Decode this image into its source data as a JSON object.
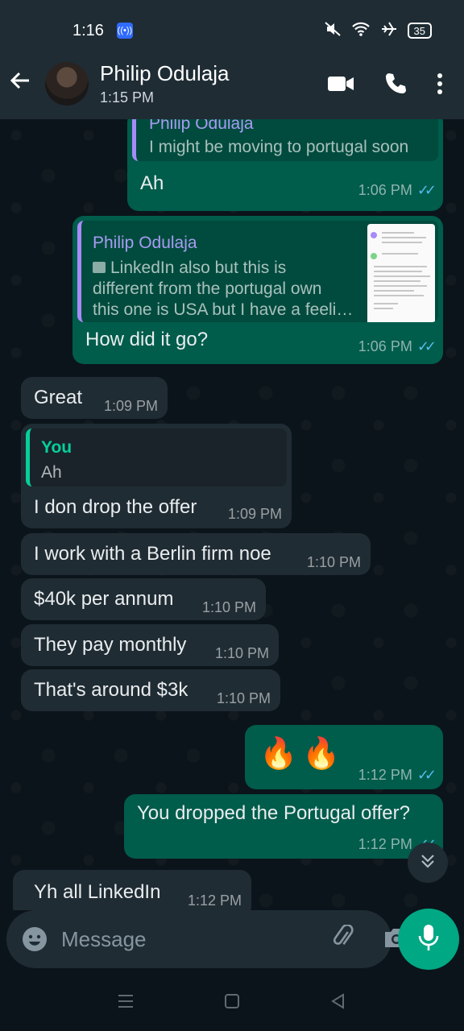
{
  "status": {
    "time": "1:16",
    "battery": "35",
    "badge_icon": "hotspot-icon"
  },
  "header": {
    "contact_name": "Philip Odulaja",
    "contact_status": "1:15 PM",
    "icons": [
      "back-arrow-icon",
      "video-call-icon",
      "voice-call-icon",
      "more-options-icon"
    ]
  },
  "messages": [
    {
      "dir": "out",
      "quote_author": "Philip Odulaja",
      "quote_text": "I might be moving to portugal soon",
      "text": "Ah",
      "time": "1:06 PM",
      "ticks": "read"
    },
    {
      "dir": "out",
      "quote_author": "Philip Odulaja",
      "quote_text_1": "LinkedIn also but this is",
      "quote_text_2": "different from the portugal own",
      "quote_text_3": "this one is USA but I have a feeli…",
      "text": "How did it go?",
      "time": "1:06 PM",
      "ticks": "read"
    },
    {
      "dir": "in",
      "text": "Great",
      "time": "1:09 PM"
    },
    {
      "dir": "in",
      "quote_author": "You",
      "quote_text": "Ah",
      "text": "I don drop the offer",
      "time": "1:09 PM"
    },
    {
      "dir": "in",
      "text": "I work with a Berlin firm noe",
      "time": "1:10 PM"
    },
    {
      "dir": "in",
      "text": "$40k per annum",
      "time": "1:10 PM"
    },
    {
      "dir": "in",
      "text": "They pay monthly",
      "time": "1:10 PM"
    },
    {
      "dir": "in",
      "text": "That's around $3k",
      "time": "1:10 PM"
    },
    {
      "dir": "out",
      "text": "🔥🔥",
      "time": "1:12 PM",
      "ticks": "read"
    },
    {
      "dir": "out",
      "text": "You dropped the Portugal offer?",
      "time": "1:12 PM",
      "ticks": "read"
    },
    {
      "dir": "in",
      "text": "Yh all LinkedIn",
      "time": "1:12 PM"
    }
  ],
  "composer": {
    "placeholder": "Message",
    "icons": [
      "emoji-icon",
      "attach-icon",
      "camera-icon",
      "mic-icon"
    ]
  },
  "colors": {
    "outgoing_bubble": "#005c4b",
    "incoming_bubble": "#202c33",
    "accent": "#00a884",
    "read_ticks": "#53bdeb"
  }
}
